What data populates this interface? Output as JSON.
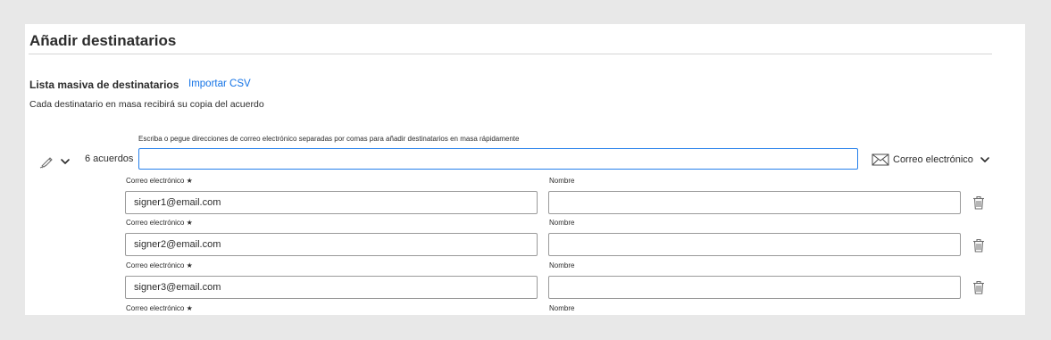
{
  "header": {
    "title": "Añadir destinatarios"
  },
  "bulk": {
    "section_title": "Lista masiva de destinatarios",
    "import_link": "Importar CSV",
    "description": "Cada destinatario en masa recibirá su copia del acuerdo",
    "hint": "Escriba o pegue direcciones de correo electrónico separadas por comas para añadir destinatarios en masa rápidamente",
    "count": "6 acuerdos",
    "input_value": "",
    "role_icon": "pen-sign-icon",
    "delivery_method": {
      "label": "Correo electrónico",
      "icon": "envelope-icon"
    }
  },
  "rows": [
    {
      "email_label": "Correo electrónico ★",
      "name_label": "Nombre",
      "email": "signer1@email.com",
      "name": ""
    },
    {
      "email_label": "Correo electrónico ★",
      "name_label": "Nombre",
      "email": "signer2@email.com",
      "name": ""
    },
    {
      "email_label": "Correo electrónico ★",
      "name_label": "Nombre",
      "email": "signer3@email.com",
      "name": ""
    },
    {
      "email_label": "Correo electrónico ★",
      "name_label": "Nombre"
    }
  ],
  "colors": {
    "accent": "#1473e6",
    "focus_border": "#2680eb",
    "background": "#e8e8e8",
    "panel": "#ffffff"
  }
}
